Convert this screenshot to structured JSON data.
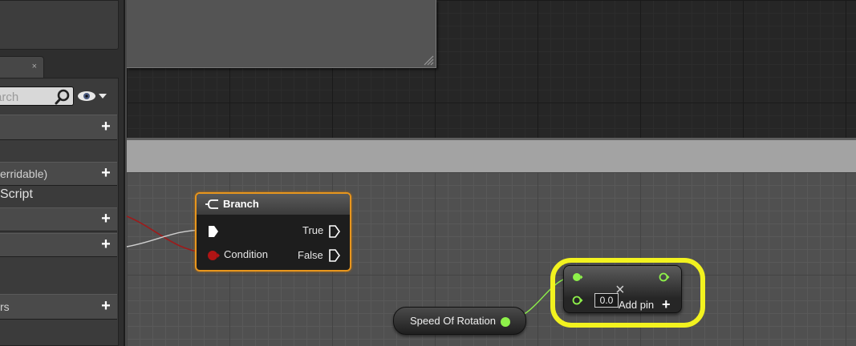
{
  "left_panel": {
    "tab_close": "×",
    "search": {
      "placeholder": "arch"
    },
    "rows": [
      {
        "label": "",
        "plus": "+"
      },
      {
        "label": "erridable)",
        "plus": "+"
      },
      {
        "label": "",
        "plus": "+"
      },
      {
        "label": "",
        "plus": "+"
      },
      {
        "label": "rs",
        "plus": "+"
      }
    ],
    "script_label": "Script"
  },
  "branch_node": {
    "title": "Branch",
    "true_label": "True",
    "false_label": "False",
    "condition_label": "Condition",
    "header_color": "#3c3c3c",
    "border_color": "#e8961d",
    "condition_pin_color": "#b01414"
  },
  "speed_node": {
    "label": "Speed Of Rotation",
    "pin_color": "#8ef14a"
  },
  "add_node": {
    "value": "0.0",
    "op_glyph": "×",
    "add_pin_label": "Add pin",
    "add_pin_plus": "+",
    "highlight_color": "#f2f21f"
  }
}
